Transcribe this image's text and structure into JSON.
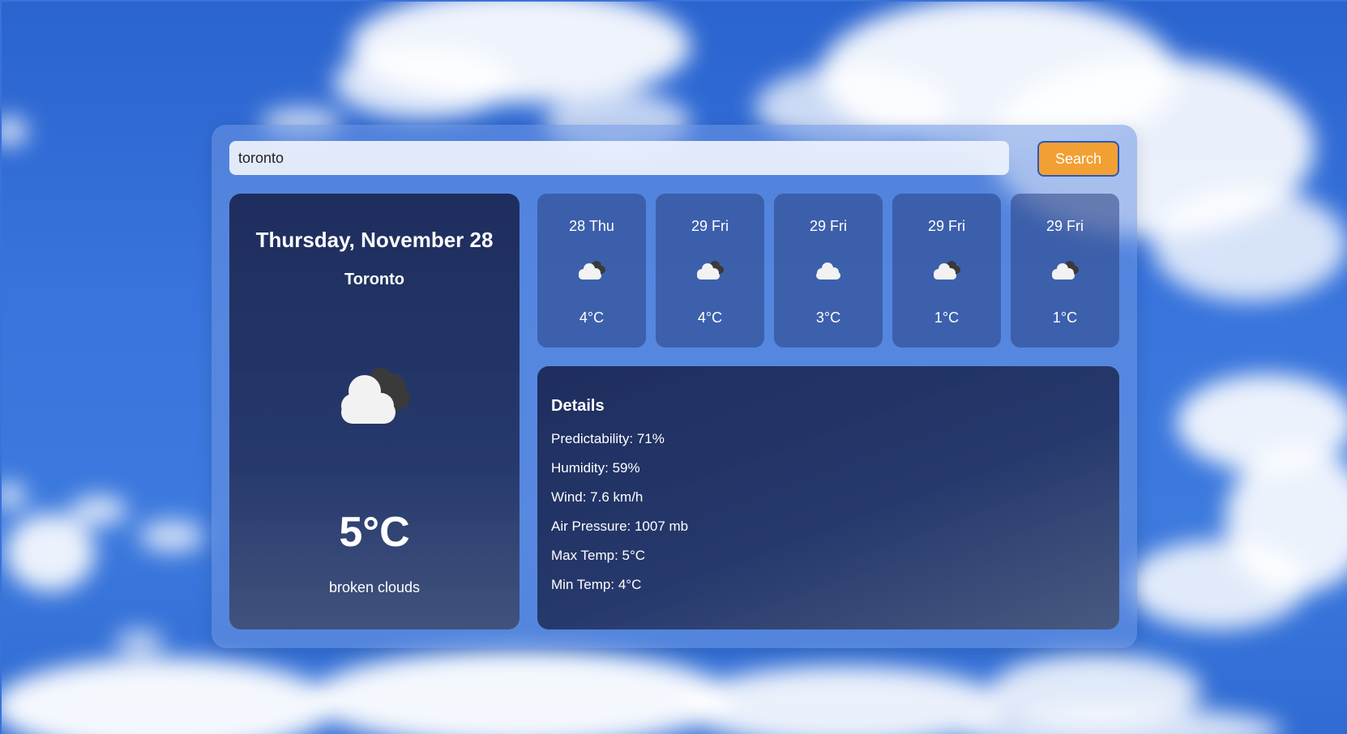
{
  "search": {
    "value": "toronto",
    "placeholder": "",
    "button_label": "Search"
  },
  "current": {
    "date": "Thursday, November 28",
    "city": "Toronto",
    "icon": "broken-clouds-icon",
    "temperature": "5°C",
    "description": "broken clouds"
  },
  "forecast": [
    {
      "day": "28 Thu",
      "icon": "broken-clouds-icon",
      "temperature": "4°C"
    },
    {
      "day": "29 Fri",
      "icon": "broken-clouds-icon",
      "temperature": "4°C"
    },
    {
      "day": "29 Fri",
      "icon": "cloud-icon",
      "temperature": "3°C"
    },
    {
      "day": "29 Fri",
      "icon": "broken-clouds-icon",
      "temperature": "1°C"
    },
    {
      "day": "29 Fri",
      "icon": "broken-clouds-icon",
      "temperature": "1°C"
    }
  ],
  "details": {
    "title": "Details",
    "rows": [
      "Predictability: 71%",
      "Humidity: 59%",
      "Wind: 7.6 km/h",
      "Air Pressure: 1007 mb",
      "Max Temp: 5°C",
      "Min Temp: 4°C"
    ]
  },
  "colors": {
    "sky": "#3874dc",
    "search_button": "#f2a033",
    "card_dark": "#1c2a58"
  }
}
